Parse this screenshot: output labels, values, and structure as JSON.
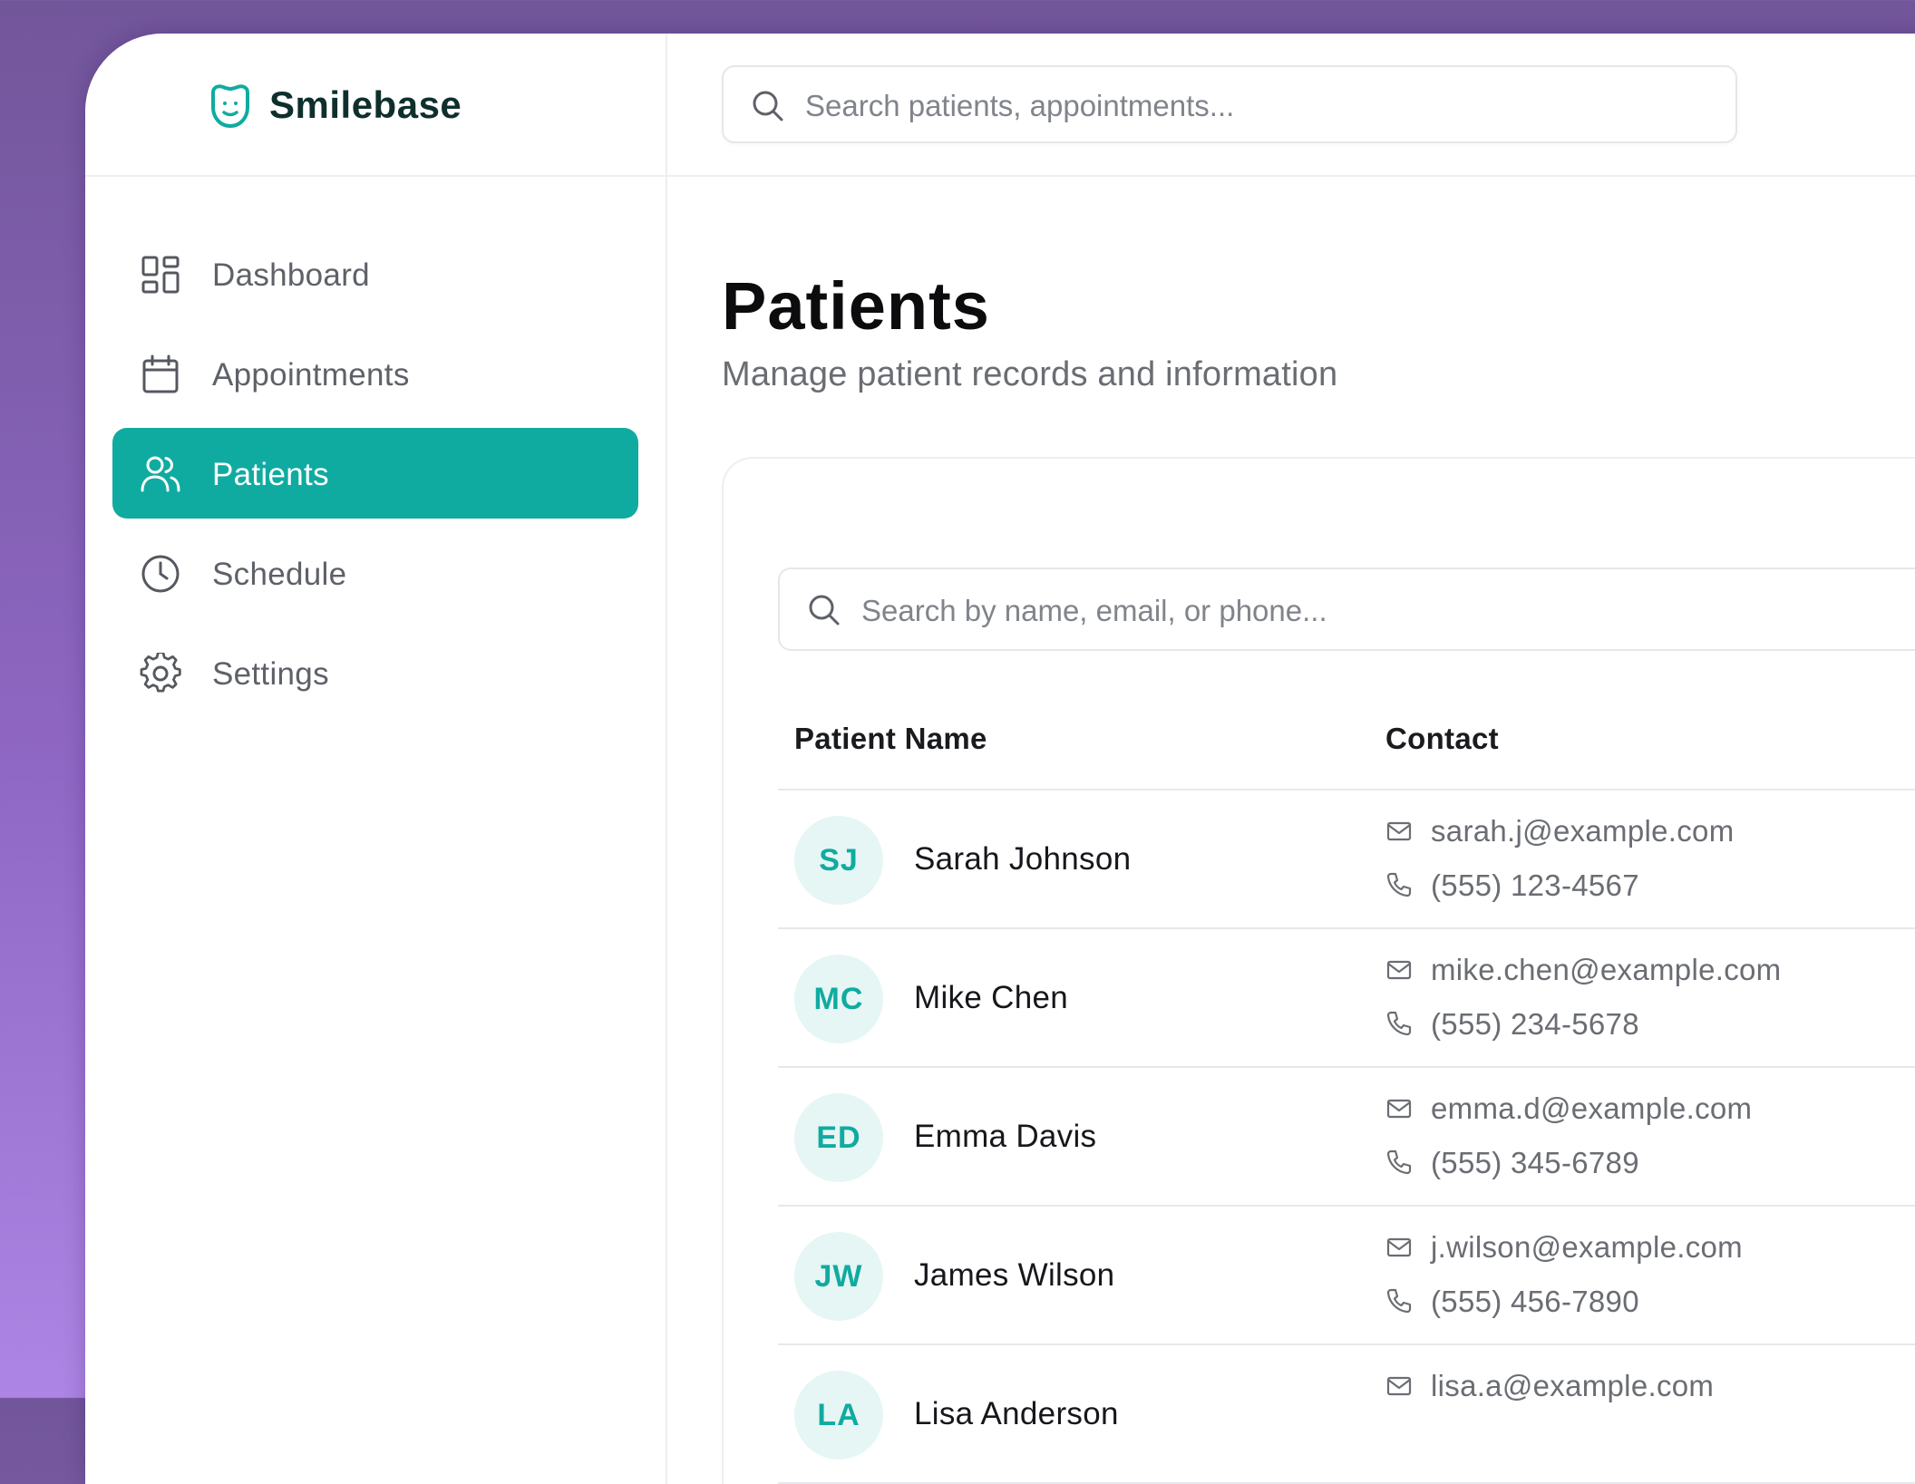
{
  "app": {
    "name": "Smilebase"
  },
  "nav": {
    "items": [
      {
        "label": "Dashboard",
        "icon": "dashboard-icon",
        "active": false
      },
      {
        "label": "Appointments",
        "icon": "calendar-icon",
        "active": false
      },
      {
        "label": "Patients",
        "icon": "users-icon",
        "active": true
      },
      {
        "label": "Schedule",
        "icon": "clock-icon",
        "active": false
      },
      {
        "label": "Settings",
        "icon": "gear-icon",
        "active": false
      }
    ]
  },
  "search": {
    "placeholder": "Search patients, appointments..."
  },
  "page": {
    "title": "Patients",
    "subtitle": "Manage patient records and information"
  },
  "patients_table": {
    "search_placeholder": "Search by name, email, or phone...",
    "headers": {
      "name": "Patient Name",
      "contact": "Contact"
    },
    "rows": [
      {
        "initials": "SJ",
        "name": "Sarah Johnson",
        "email": "sarah.j@example.com",
        "phone": "(555) 123-4567"
      },
      {
        "initials": "MC",
        "name": "Mike Chen",
        "email": "mike.chen@example.com",
        "phone": "(555) 234-5678"
      },
      {
        "initials": "ED",
        "name": "Emma Davis",
        "email": "emma.d@example.com",
        "phone": "(555) 345-6789"
      },
      {
        "initials": "JW",
        "name": "James Wilson",
        "email": "j.wilson@example.com",
        "phone": "(555) 456-7890"
      },
      {
        "initials": "LA",
        "name": "Lisa Anderson",
        "email": "lisa.a@example.com",
        "phone": ""
      }
    ]
  },
  "colors": {
    "accent": "#10aba0",
    "avatar_bg": "#e6f6f4",
    "background_gradient_top": "#72569a",
    "background_gradient_bottom": "#ad85e4"
  }
}
